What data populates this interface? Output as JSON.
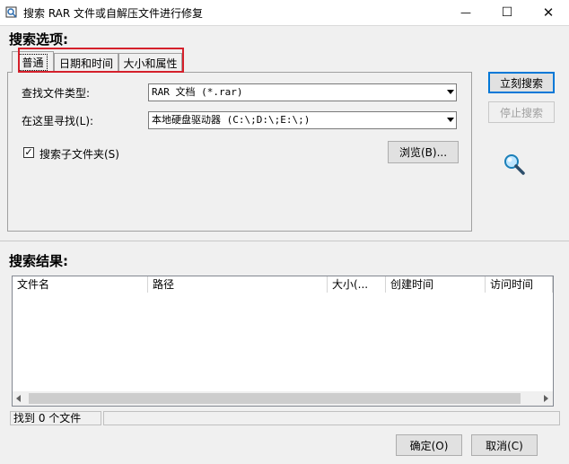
{
  "window": {
    "title": "搜索 RAR 文件或自解压文件进行修复",
    "minimize_glyph": "—",
    "maximize_glyph": "☐",
    "close_glyph": "✕"
  },
  "search_options": {
    "heading": "搜索选项:",
    "tabs": [
      {
        "label": "普通",
        "active": true
      },
      {
        "label": "日期和时间",
        "active": false
      },
      {
        "label": "大小和属性",
        "active": false
      }
    ],
    "file_type_label": "查找文件类型:",
    "file_type_value": "RAR 文档 (*.rar)",
    "look_in_label": "在这里寻找(L):",
    "look_in_value": "本地硬盘驱动器 (C:\\;D:\\;E:\\;)",
    "subfolders_label": "搜索子文件夹(S)",
    "subfolders_checked": "✓",
    "browse_label": "浏览(B)..."
  },
  "actions": {
    "search_now": "立刻搜索",
    "stop_search": "停止搜索"
  },
  "results": {
    "heading": "搜索结果:",
    "columns": [
      "文件名",
      "路径",
      "大小(...",
      "创建时间",
      "访问时间"
    ],
    "status": "找到 0 个文件"
  },
  "footer": {
    "ok": "确定(O)",
    "cancel": "取消(C)"
  },
  "colors": {
    "highlight_box": "#d5202b",
    "default_button_border": "#0078d7"
  },
  "icons": [
    "app-icon",
    "magnifier-icon",
    "combo-dropdown-icon",
    "scroll-left-icon",
    "scroll-right-icon"
  ]
}
